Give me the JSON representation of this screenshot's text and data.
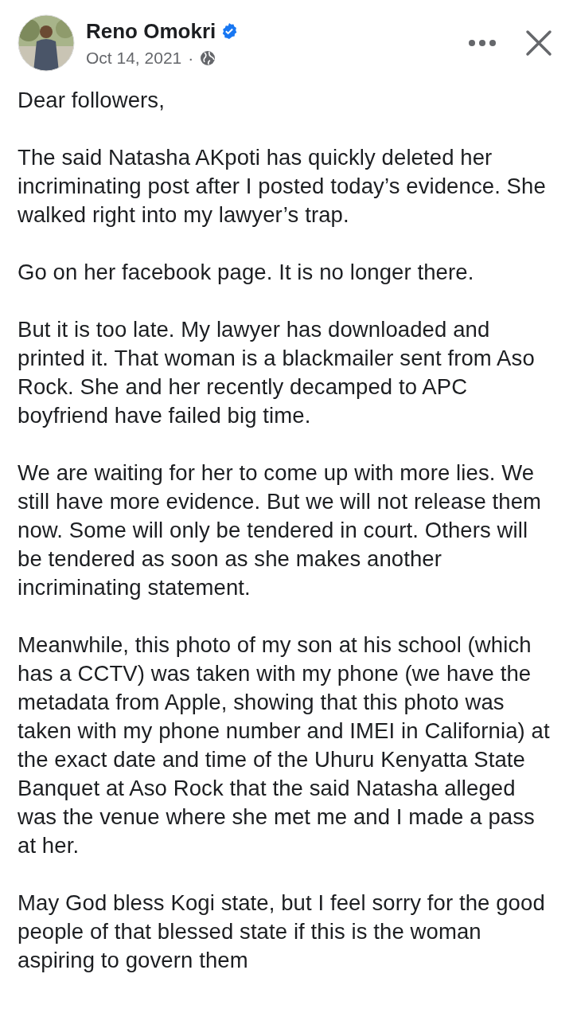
{
  "post": {
    "author": "Reno Omokri",
    "verified": true,
    "date": "Oct 14, 2021",
    "separator": "·",
    "paragraphs": [
      "Dear followers,",
      "The said Natasha AKpoti has quickly deleted her incriminating post after I posted today’s evidence. She walked right into my lawyer’s trap.",
      "Go on her facebook page. It is no longer there.",
      "But it is too late. My lawyer has downloaded and printed it. That woman is a blackmailer sent from Aso Rock. She and her recently decamped to APC boyfriend have failed big time.",
      "We are waiting for her to come up with more lies. We still have more evidence. But we will not release them now. Some will only be tendered in court. Others will be tendered as soon as she makes another incriminating statement.",
      "Meanwhile, this photo of my son at his school (which has a CCTV) was taken with my phone (we have the metadata from Apple, showing that this photo was taken with my phone number and IMEI in California) at the exact date and time of the Uhuru Kenyatta State Banquet at Aso Rock that the said Natasha alleged was the venue where she met me and I made a pass at her.",
      "May God bless Kogi state, but I feel sorry for the good people of that blessed state if this is the woman aspiring to govern them"
    ]
  }
}
